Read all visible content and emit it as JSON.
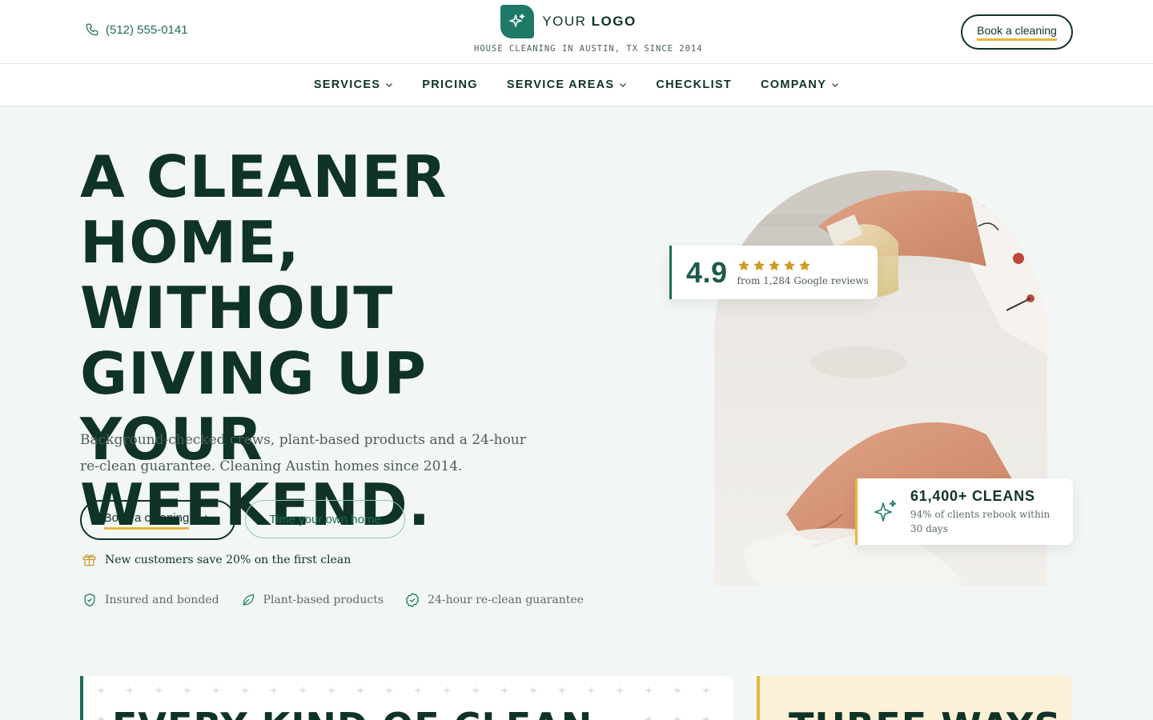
{
  "header": {
    "phone": "(512) 555-0141",
    "logo_prefix": "YOUR",
    "logo_bold": "LOGO",
    "tagline": "HOUSE CLEANING IN AUSTIN, TX SINCE 2014",
    "book_label": "Book a cleaning"
  },
  "nav": {
    "items": [
      {
        "label": "SERVICES",
        "has_dropdown": true
      },
      {
        "label": "PRICING",
        "has_dropdown": false
      },
      {
        "label": "SERVICE AREAS",
        "has_dropdown": true
      },
      {
        "label": "CHECKLIST",
        "has_dropdown": false
      },
      {
        "label": "COMPANY",
        "has_dropdown": true
      }
    ]
  },
  "hero": {
    "headline_lines": [
      "A CLEANER",
      "HOME, WITHOUT",
      "GIVING UP",
      "YOUR WEEKEND."
    ],
    "subtext": "Background-checked crews, plant-based products and a 24-hour re-clean guarantee. Cleaning Austin homes since 2014.",
    "primary_cta": "Book a cleaning",
    "secondary_cta": "Time your own home",
    "promo": "New customers save 20% on the first clean",
    "features": [
      {
        "icon": "shield-check-icon",
        "label": "Insured and bonded"
      },
      {
        "icon": "leaf-icon",
        "label": "Plant-based products"
      },
      {
        "icon": "badge-check-icon",
        "label": "24-hour re-clean guarantee"
      }
    ]
  },
  "rating": {
    "score": "4.9",
    "stars": 5,
    "label": "from 1,284 Google reviews"
  },
  "stats": {
    "title": "61,400+ CLEANS",
    "subtitle": "94% of clients rebook within 30 days"
  },
  "sections": {
    "left_heading": "EVERY KIND OF CLEAN",
    "right_heading": "THREE WAYS"
  },
  "colors": {
    "brand_green": "#1e7a66",
    "dark_text": "#0f3327",
    "accent_gold": "#e8b63c",
    "page_bg": "#f2f7f5"
  }
}
